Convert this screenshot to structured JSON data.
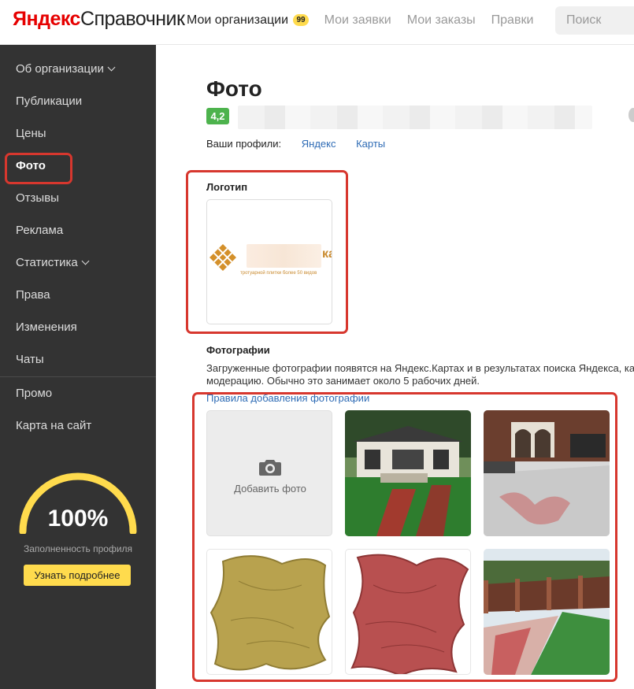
{
  "header": {
    "brand": "Яндекс",
    "product": "Справочник",
    "nav": [
      {
        "label": "Мои организации",
        "badge": "99"
      },
      {
        "label": "Мои заявки"
      },
      {
        "label": "Мои заказы"
      },
      {
        "label": "Правки"
      }
    ],
    "search_placeholder": "Поиск"
  },
  "sidebar": {
    "items": [
      {
        "label": "Об организации"
      },
      {
        "label": "Публикации"
      },
      {
        "label": "Цены"
      },
      {
        "label": "Фото"
      },
      {
        "label": "Отзывы"
      },
      {
        "label": "Реклама"
      },
      {
        "label": "Статистика"
      },
      {
        "label": "Права"
      },
      {
        "label": "Изменения"
      },
      {
        "label": "Чаты"
      }
    ],
    "extra": [
      {
        "label": "Промо"
      },
      {
        "label": "Карта на сайт"
      }
    ],
    "completeness": {
      "percent": "100%",
      "value": 1.0,
      "label": "Заполненность профиля",
      "button": "Узнать подробнее"
    },
    "colors": {
      "gauge": "#ffdb4d",
      "active_outline": "#d7372e"
    }
  },
  "main": {
    "title": "Фото",
    "rating": "4,2",
    "profiles_label": "Ваши профили:",
    "profile_links": [
      "Яндекс",
      "Карты"
    ],
    "logo_section": {
      "title": "Логотип",
      "logo_tail": "ка",
      "logo_slogan": "тротуарной плитки более 50 видов"
    },
    "photos_section": {
      "title": "Фотографии",
      "desc_line1": "Загруженные фотографии появятся на Яндекс.Картах и в результатах поиска Яндекса, ка",
      "desc_line2": "модерацию. Обычно это занимает около 5 рабочих дней.",
      "rules_link": "Правила добавления фотографии",
      "add_photo": "Добавить фото"
    }
  }
}
